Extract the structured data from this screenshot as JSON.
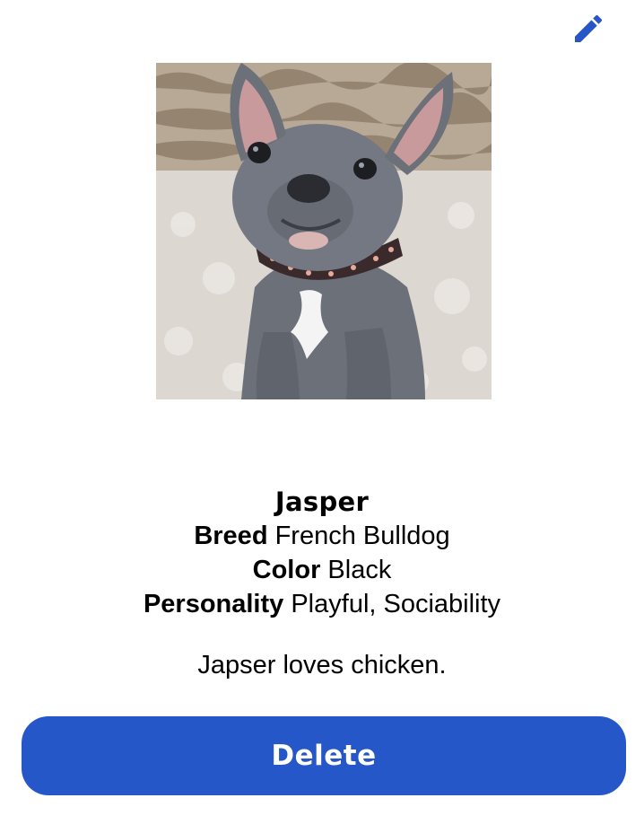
{
  "header": {
    "edit_icon": "pencil-icon",
    "accent_color": "#2657c8"
  },
  "pet": {
    "photo_subject": "grey french bulldog puppy",
    "name": "Jasper",
    "breed_label": "Breed",
    "breed_value": "French Bulldog",
    "color_label": "Color",
    "color_value": "Black",
    "personality_label": "Personality",
    "personality_value": "Playful, Sociability",
    "description": "Japser loves chicken."
  },
  "actions": {
    "delete_label": "Delete",
    "delete_color": "#2657c8"
  }
}
